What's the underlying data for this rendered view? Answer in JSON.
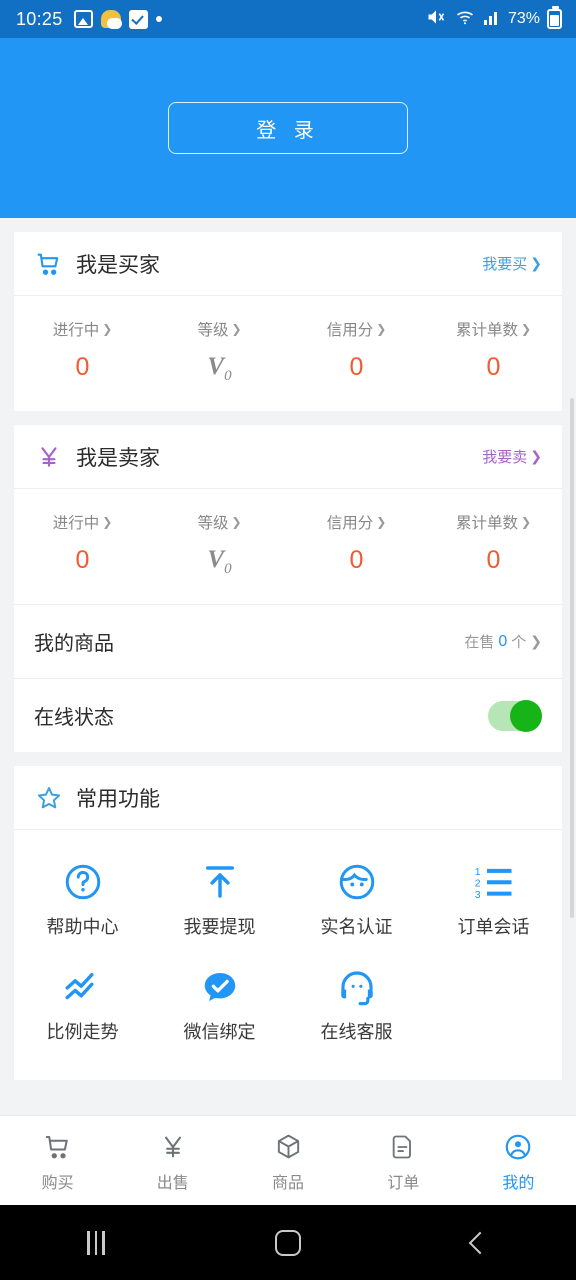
{
  "status_bar": {
    "time": "10:25",
    "battery": "73%",
    "icons": [
      "gallery-icon",
      "weather-icon",
      "task-icon",
      "dot-icon",
      "mute-icon",
      "wifi-icon",
      "signal-icon",
      "battery-icon"
    ]
  },
  "header": {
    "login_label": "登 录",
    "bg_color": "#2196f5"
  },
  "buyer_card": {
    "icon": "shopping-cart-icon",
    "title": "我是买家",
    "link_label": "我要买",
    "link_color": "#3d9fe0",
    "stats": [
      {
        "label": "进行中",
        "value": "0",
        "type": "number"
      },
      {
        "label": "等级",
        "value": "V",
        "sub": "0",
        "type": "level"
      },
      {
        "label": "信用分",
        "value": "0",
        "type": "number"
      },
      {
        "label": "累计单数",
        "value": "0",
        "type": "number"
      }
    ]
  },
  "seller_card": {
    "icon": "yen-icon",
    "title": "我是卖家",
    "link_label": "我要卖",
    "link_color": "#a665c8",
    "stats": [
      {
        "label": "进行中",
        "value": "0",
        "type": "number"
      },
      {
        "label": "等级",
        "value": "V",
        "sub": "0",
        "type": "level"
      },
      {
        "label": "信用分",
        "value": "0",
        "type": "number"
      },
      {
        "label": "累计单数",
        "value": "0",
        "type": "number"
      }
    ],
    "rows": [
      {
        "label": "我的商品",
        "right_prefix": "在售",
        "right_count": "0",
        "right_suffix": "个",
        "type": "link"
      },
      {
        "label": "在线状态",
        "type": "toggle",
        "toggle_on": true
      }
    ]
  },
  "functions_card": {
    "icon": "star-icon",
    "title": "常用功能",
    "items": [
      {
        "label": "帮助中心",
        "icon": "question-circle-icon"
      },
      {
        "label": "我要提现",
        "icon": "withdraw-arrow-icon"
      },
      {
        "label": "实名认证",
        "icon": "face-id-icon"
      },
      {
        "label": "订单会话",
        "icon": "numbered-list-icon"
      },
      {
        "label": "比例走势",
        "icon": "trend-chart-icon"
      },
      {
        "label": "微信绑定",
        "icon": "wechat-check-icon"
      },
      {
        "label": "在线客服",
        "icon": "headset-support-icon"
      }
    ]
  },
  "tabbar": {
    "active_color": "#2196f5",
    "tabs": [
      {
        "label": "购买",
        "icon": "cart-icon",
        "active": false
      },
      {
        "label": "出售",
        "icon": "yen-icon",
        "active": false
      },
      {
        "label": "商品",
        "icon": "box-icon",
        "active": false
      },
      {
        "label": "订单",
        "icon": "document-icon",
        "active": false
      },
      {
        "label": "我的",
        "icon": "person-circle-icon",
        "active": true
      }
    ]
  },
  "android_nav": {
    "recents": "recents-icon",
    "home": "home-icon",
    "back": "back-icon"
  }
}
